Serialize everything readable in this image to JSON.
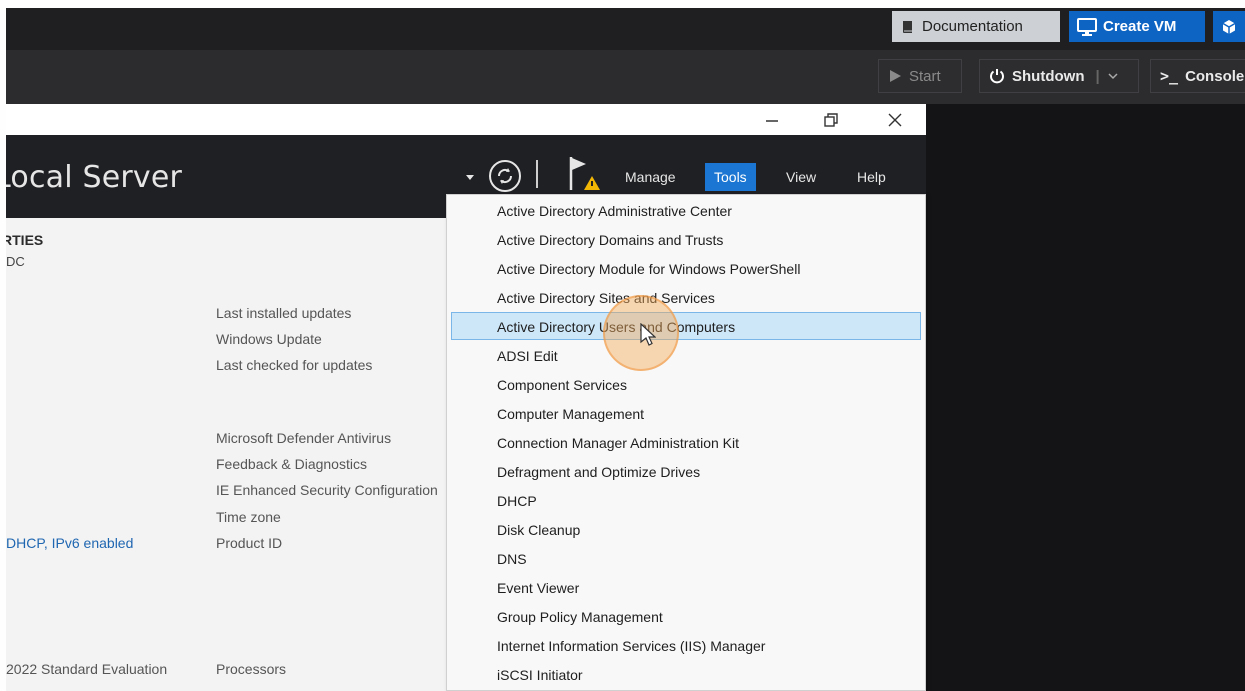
{
  "topbar": {
    "documentation_label": "Documentation",
    "create_vm_label": "Create VM"
  },
  "vm_toolbar": {
    "start_label": "Start",
    "shutdown_label": "Shutdown",
    "console_label": "Console"
  },
  "server_manager": {
    "page_title": "Local Server",
    "menu": {
      "manage": "Manage",
      "tools": "Tools",
      "view": "View",
      "help": "Help"
    },
    "section_title": "PROPERTIES",
    "section_subtitle": "DC",
    "properties_right": [
      "Last installed updates",
      "Windows Update",
      "Last checked for updates",
      "Microsoft Defender Antivirus",
      "Feedback & Diagnostics",
      "IE Enhanced Security Configuration",
      "Time zone",
      "Product ID",
      "Processors"
    ],
    "ethernet_value": "DHCP, IPv6 enabled",
    "os_value": "2022 Standard Evaluation"
  },
  "tools_menu": {
    "items": [
      "Active Directory Administrative Center",
      "Active Directory Domains and Trusts",
      "Active Directory Module for Windows PowerShell",
      "Active Directory Sites and Services",
      "Active Directory Users and Computers",
      "ADSI Edit",
      "Component Services",
      "Computer Management",
      "Connection Manager Administration Kit",
      "Defragment and Optimize Drives",
      "DHCP",
      "Disk Cleanup",
      "DNS",
      "Event Viewer",
      "Group Policy Management",
      "Internet Information Services (IIS) Manager",
      "iSCSI Initiator"
    ],
    "highlighted": "Active Directory Users and Computers"
  },
  "colors": {
    "accent": "#0d64c3",
    "tools_active": "#1a76d2",
    "header_bg": "#1f2024",
    "highlight_bg": "#cde6f8",
    "click_marker": "#f5aa5a"
  }
}
